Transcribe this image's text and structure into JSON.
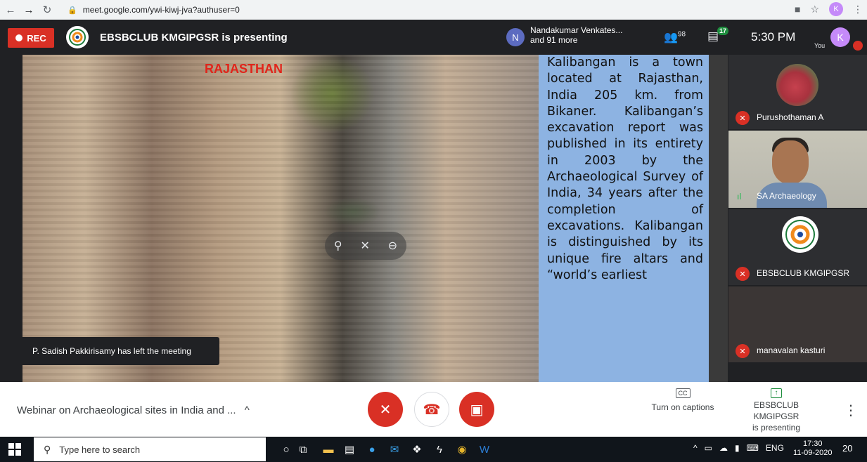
{
  "browser": {
    "url": "meet.google.com/ywi-kiwj-jva?authuser=0",
    "profile_initial": "K"
  },
  "meet_top": {
    "rec_label": "REC",
    "presenting_title": "EBSBCLUB KMGIPGSR is presenting",
    "presenter_initial": "N",
    "presenter_line1": "Nandakumar Venkates...",
    "presenter_line2": "and 91 more",
    "people_count": "98",
    "chat_badge": "17",
    "time": "5:30 PM",
    "self_initial": "K",
    "self_label": "You"
  },
  "slide": {
    "caption": "RAJASTHAN",
    "text": "Kalibangan is a town located at Rajasthan, India 205 km. from Bikaner. Kalibangan’s excavation report was published in its entirety in 2003 by the Archaeological Survey of India, 34 years after the completion of excavations. Kalibangan is distinguished by its unique fire altars and “world’s earliest"
  },
  "toast": {
    "message": "P. Sadish Pakkirisamy has left the meeting"
  },
  "participants": [
    {
      "name": "Purushothaman A",
      "muted": true
    },
    {
      "name": "SA Archaeology",
      "muted": false
    },
    {
      "name": "EBSBCLUB KMGIPGSR",
      "muted": true
    },
    {
      "name": "manavalan kasturi",
      "muted": true
    }
  ],
  "meet_bottom": {
    "meeting_title": "Webinar on Archaeological sites in India and ...",
    "captions_label": "Turn on captions",
    "captions_icon": "CC",
    "presenting_line1": "EBSBCLUB KMGIPGSR",
    "presenting_line2": "is presenting"
  },
  "taskbar": {
    "search_placeholder": "Type here to search",
    "lang": "ENG",
    "time": "17:30",
    "date": "11-09-2020",
    "notifications": "20"
  },
  "colors": {
    "rec": "#d93025",
    "slide_bg": "#8db3e2",
    "caption": "#e0251b",
    "meet_dark": "#202124"
  }
}
